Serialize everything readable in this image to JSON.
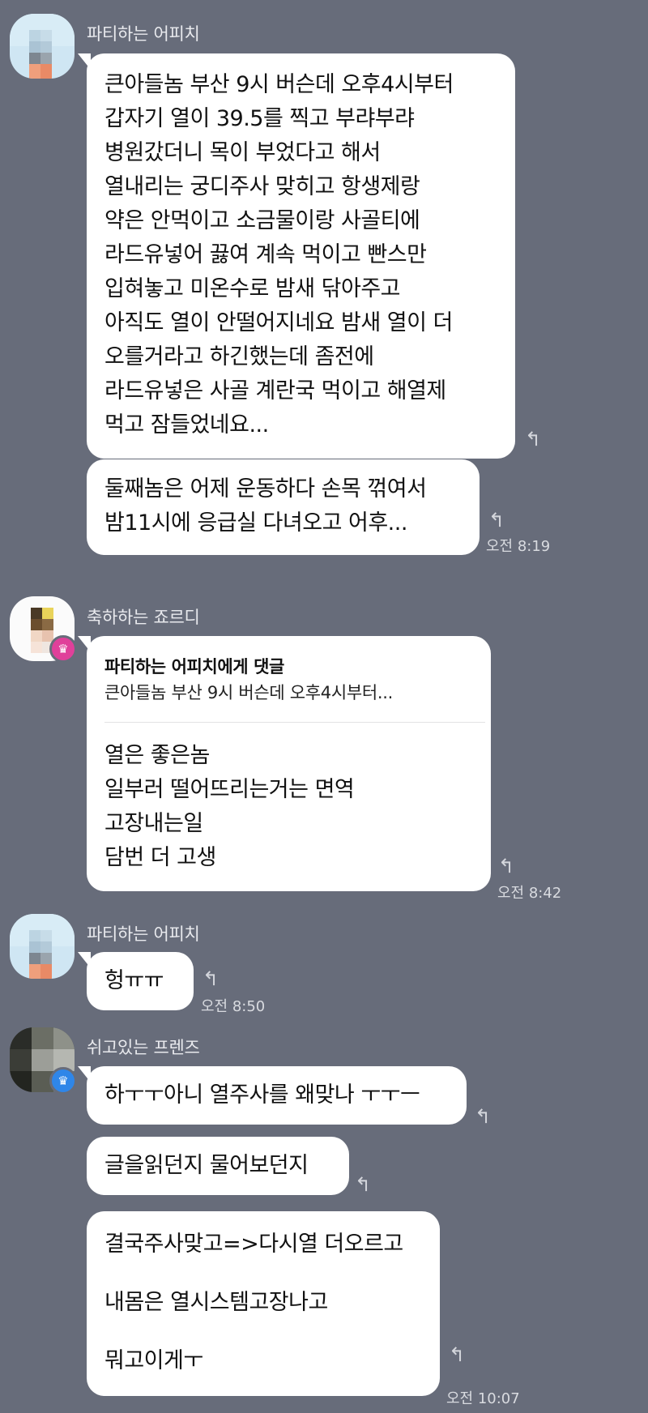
{
  "senders": {
    "apeach": "파티하는 어피치",
    "jordy": "축하하는 죠르디",
    "friends": "쉬고있는 프렌즈"
  },
  "messages": {
    "m1": [
      " 큰아들놈 부산 9시 버슨데 오후4시부터",
      "갑자기 열이 39.5를 찍고 부랴부랴",
      "병원갔더니 목이 부었다고 해서",
      "열내리는 궁디주사 맞히고 항생제랑",
      "약은 안먹이고 소금물이랑 사골티에",
      "라드유넣어 끓여 계속 먹이고 빤스만",
      "입혀놓고 미온수로 밤새 닦아주고",
      "아직도 열이 안떨어지네요 밤새 열이 더",
      "오를거라고 하긴했는데 좀전에",
      "라드유넣은 사골 계란국 먹이고 해열제",
      "먹고 잠들었네요..."
    ],
    "m2": [
      "둘째놈은 어제 운동하다 손목 꺾여서",
      "밤11시에 응급실 다녀오고 어후..."
    ],
    "m3_quote_head": "파티하는 어피치에게 댓글",
    "m3_quote_text": "큰아들놈 부산 9시 버슨데 오후4시부터...",
    "m3": [
      "열은 좋은놈",
      "일부러 떨어뜨리는거는 면역",
      "고장내는일",
      "담번 더 고생"
    ],
    "m4": [
      "헝ㅠㅠ"
    ],
    "m5": [
      "하ㅜㅜ아니 열주사를 왜맞나 ㅜㅜㅡ"
    ],
    "m6": [
      "글을읽던지 물어보던지"
    ],
    "m7": [
      "결국주사맞고=>다시열 더오르고",
      "",
      "내몸은 열시스템고장나고",
      "",
      "뭐고이게ㅜ"
    ]
  },
  "times": {
    "t1": "오전 8:19",
    "t2": "오전 8:42",
    "t3": "오전 8:50",
    "t4": "오전 10:07"
  },
  "icons": {
    "reply": "reply-arrow-icon",
    "crown": "crown-icon",
    "crown_pink": "#e0409a",
    "crown_blue": "#2f86e8"
  }
}
